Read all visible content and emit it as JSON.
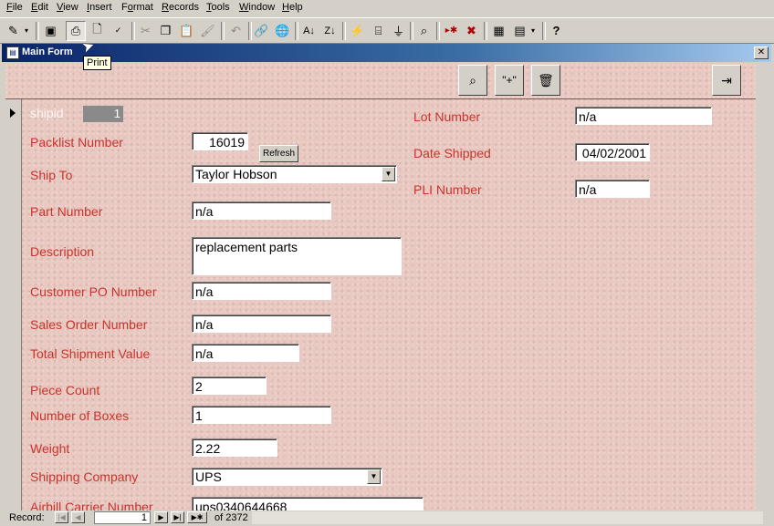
{
  "menu": [
    "File",
    "Edit",
    "View",
    "Insert",
    "Format",
    "Records",
    "Tools",
    "Window",
    "Help"
  ],
  "menu_underline": [
    "F",
    "E",
    "V",
    "I",
    "o",
    "R",
    "T",
    "W",
    "H"
  ],
  "tooltip": "Print",
  "window": {
    "title": "Main Form",
    "close_glyph": "✕",
    "icon_glyph": "▤"
  },
  "form": {
    "shipid_label": "shipid",
    "shipid_value": "1",
    "packlist_label": "Packlist Number",
    "packlist_value": "16019",
    "refresh_label": "Refresh",
    "ship_to_label": "Ship To",
    "ship_to_value": "Taylor Hobson",
    "part_number_label": "Part Number",
    "part_number_value": "n/a",
    "description_label": "Description",
    "description_value": "replacement parts",
    "customer_po_label": "Customer PO Number",
    "customer_po_value": "n/a",
    "sales_order_label": "Sales Order Number",
    "sales_order_value": "n/a",
    "total_value_label": "Total Shipment Value",
    "total_value_value": "n/a",
    "piece_count_label": "Piece Count",
    "piece_count_value": "2",
    "boxes_label": "Number of Boxes",
    "boxes_value": "1",
    "weight_label": "Weight",
    "weight_value": "2.22",
    "shipping_company_label": "Shipping Company",
    "shipping_company_value": "UPS",
    "airbill_label": "Airbill Carrier Number",
    "airbill_value": "ups0340644668",
    "lot_number_label": "Lot Number",
    "lot_number_value": "n/a",
    "date_shipped_label": "Date Shipped",
    "date_shipped_value": "04/02/2001",
    "pli_label": "PLI Number",
    "pli_value": "n/a"
  },
  "header_buttons": {
    "find": "binoculars-icon",
    "add": "\"+\"",
    "delete": "trash-icon",
    "exit": "exit-door-icon"
  },
  "record_nav": {
    "label": "Record:",
    "current": "1",
    "of_label": "of",
    "total": "2372"
  },
  "colors": {
    "form_background": "#e8c8c0",
    "label_text": "#c8342c",
    "title_bar": "#0a246a"
  }
}
